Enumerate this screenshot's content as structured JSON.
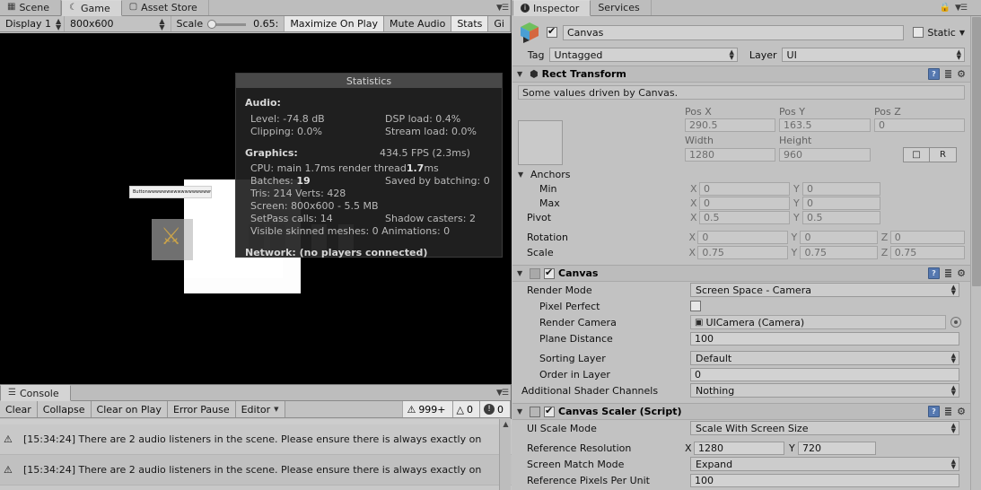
{
  "game_pane": {
    "tabs": [
      {
        "label": "Scene",
        "icon": "grid-icon",
        "active": false
      },
      {
        "label": "Game",
        "icon": "gamepad-icon",
        "active": true
      },
      {
        "label": "Asset Store",
        "icon": "store-icon",
        "active": false
      }
    ],
    "toolbar": {
      "display": "Display 1",
      "resolution": "800x600",
      "scale_label": "Scale",
      "scale_value": "0.65:",
      "maximize_on_play": "Maximize On Play",
      "mute_audio": "Mute Audio",
      "stats": "Stats",
      "gizmos": "Gi"
    },
    "content": {
      "button_label": "Buttonwwwwwwwwwwwwwwwwwwwww"
    },
    "statistics": {
      "title": "Statistics",
      "audio_heading": "Audio:",
      "audio_rows": [
        {
          "left": "Level: -74.8 dB",
          "right": "DSP load: 0.4%"
        },
        {
          "left": "Clipping: 0.0%",
          "right": "Stream load: 0.0%"
        }
      ],
      "graphics_heading": "Graphics:",
      "fps": "434.5 FPS (2.3ms)",
      "cpu_prefix": "CPU: main 1.7ms  render thread ",
      "cpu_render": "1.7",
      "cpu_suffix": "ms",
      "batches_label": "Batches: ",
      "batches_value": "19",
      "saved_by_batching": "Saved by batching: 0",
      "tris_verts": "Tris: 214 Verts: 428",
      "screen": "Screen: 800x600 - 5.5 MB",
      "setpass": "SetPass calls: 14",
      "shadow_casters": "Shadow casters: 2",
      "skinned_meshes": "Visible skinned meshes: 0  Animations: 0",
      "network": "Network: (no players connected)"
    }
  },
  "console_pane": {
    "tab": "Console",
    "toolbar": {
      "clear": "Clear",
      "collapse": "Collapse",
      "clear_on_play": "Clear on Play",
      "error_pause": "Error Pause",
      "editor": "Editor"
    },
    "counters": {
      "log": "999+",
      "warning": "0",
      "error": "0"
    },
    "messages": [
      {
        "icon": "warning-log-icon",
        "text": "[15:34:24] There are 2 audio listeners in the scene. Please ensure there is always exactly on"
      },
      {
        "icon": "warning-log-icon",
        "text": "[15:34:24] There are 2 audio listeners in the scene. Please ensure there is always exactly on"
      }
    ]
  },
  "inspector": {
    "tabs": [
      {
        "label": "Inspector",
        "icon": "info-icon",
        "active": true
      },
      {
        "label": "Services",
        "icon": "services-icon",
        "active": false
      }
    ],
    "object": {
      "enabled": true,
      "name": "Canvas",
      "static_label": "Static",
      "static_checked": false,
      "tag_label": "Tag",
      "tag_value": "Untagged",
      "layer_label": "Layer",
      "layer_value": "UI"
    },
    "rect_transform": {
      "title": "Rect Transform",
      "info": "Some values driven by Canvas.",
      "pos_x_label": "Pos X",
      "pos_y_label": "Pos Y",
      "pos_z_label": "Pos Z",
      "pos_x": "290.5",
      "pos_y": "163.5",
      "pos_z": "0",
      "width_label": "Width",
      "height_label": "Height",
      "width": "1280",
      "height": "960",
      "blueprint_btn": "blueprint-icon",
      "raw_btn": "R",
      "anchors_label": "Anchors",
      "min_label": "Min",
      "max_label": "Max",
      "pivot_label": "Pivot",
      "anchor_min_x": "0",
      "anchor_min_y": "0",
      "anchor_max_x": "0",
      "anchor_max_y": "0",
      "pivot_x": "0.5",
      "pivot_y": "0.5",
      "rotation_label": "Rotation",
      "rotation_x": "0",
      "rotation_y": "0",
      "rotation_z": "0",
      "scale_label": "Scale",
      "scale_x": "0.75",
      "scale_y": "0.75",
      "scale_z": "0.75",
      "axis_x": "X",
      "axis_y": "Y",
      "axis_z": "Z"
    },
    "canvas": {
      "title": "Canvas",
      "enabled": true,
      "render_mode_label": "Render Mode",
      "render_mode_value": "Screen Space - Camera",
      "pixel_perfect_label": "Pixel Perfect",
      "pixel_perfect_checked": false,
      "render_camera_label": "Render Camera",
      "render_camera_value": "UICamera (Camera)",
      "plane_distance_label": "Plane Distance",
      "plane_distance_value": "100",
      "sorting_layer_label": "Sorting Layer",
      "sorting_layer_value": "Default",
      "order_in_layer_label": "Order in Layer",
      "order_in_layer_value": "0",
      "additional_shader_channels_label": "Additional Shader Channels",
      "additional_shader_channels_value": "Nothing"
    },
    "canvas_scaler": {
      "title": "Canvas Scaler (Script)",
      "enabled": true,
      "ui_scale_mode_label": "UI Scale Mode",
      "ui_scale_mode_value": "Scale With Screen Size",
      "reference_resolution_label": "Reference Resolution",
      "reference_resolution_x": "1280",
      "reference_resolution_y": "720",
      "screen_match_mode_label": "Screen Match Mode",
      "screen_match_mode_value": "Expand",
      "reference_ppu_label": "Reference Pixels Per Unit",
      "reference_ppu_value": "100",
      "axis_x": "X",
      "axis_y": "Y"
    }
  }
}
